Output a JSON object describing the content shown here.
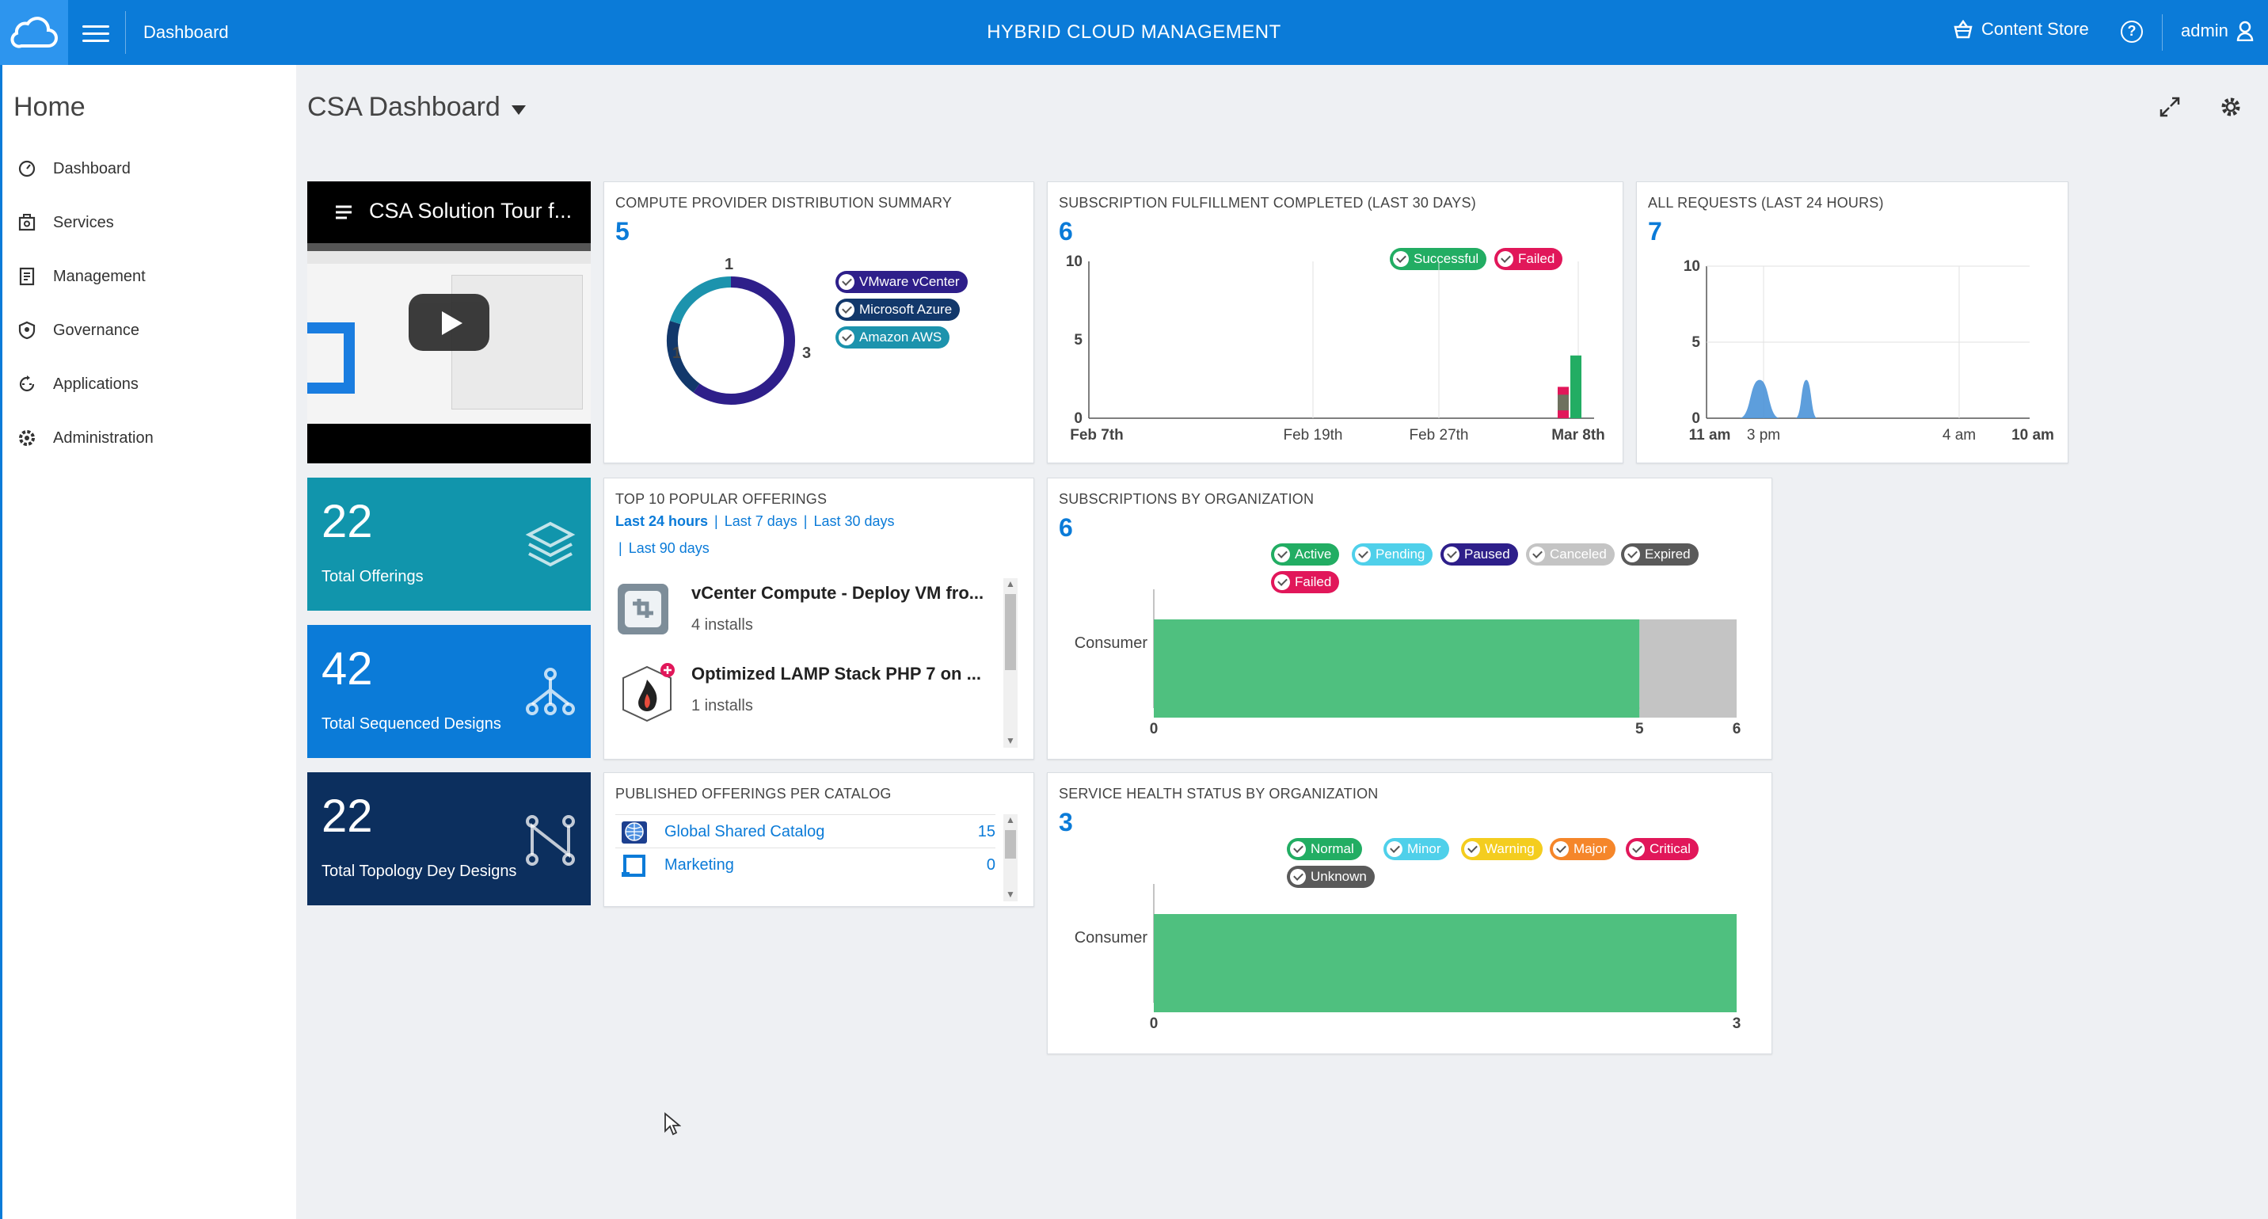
{
  "topbar": {
    "breadcrumb": "Dashboard",
    "title": "HYBRID CLOUD MANAGEMENT",
    "content_store": "Content Store",
    "help": "?",
    "user": "admin"
  },
  "sidebar": {
    "home": "Home",
    "items": [
      {
        "label": "Dashboard",
        "icon": "dashboard-icon"
      },
      {
        "label": "Services",
        "icon": "services-icon"
      },
      {
        "label": "Management",
        "icon": "management-icon"
      },
      {
        "label": "Governance",
        "icon": "governance-icon"
      },
      {
        "label": "Applications",
        "icon": "applications-icon"
      },
      {
        "label": "Administration",
        "icon": "administration-icon"
      }
    ]
  },
  "dashboard": {
    "title": "CSA Dashboard"
  },
  "video": {
    "title": "CSA Solution Tour f..."
  },
  "tiles": [
    {
      "value": "22",
      "label": "Total Offerings",
      "color": "#1195ac",
      "icon": "layers-icon"
    },
    {
      "value": "42",
      "label": "Total Sequenced Designs",
      "color": "#0b7bd8",
      "icon": "hierarchy-icon"
    },
    {
      "value": "22",
      "label": "Total Topology Dey Designs",
      "color": "#0c2f5e",
      "icon": "topology-icon"
    }
  ],
  "compute": {
    "title": "COMPUTE PROVIDER DISTRIBUTION SUMMARY",
    "count": "5",
    "legend": [
      {
        "label": "VMware vCenter",
        "color": "#2e1f8a"
      },
      {
        "label": "Microsoft Azure",
        "color": "#12386b"
      },
      {
        "label": "Amazon AWS",
        "color": "#1c93ad"
      }
    ],
    "labels": [
      "1",
      "1",
      "3"
    ]
  },
  "fulfillment": {
    "title": "SUBSCRIPTION FULFILLMENT COMPLETED (LAST 30 DAYS)",
    "count": "6",
    "legend": [
      {
        "label": "Successful",
        "color": "#22ad63"
      },
      {
        "label": "Failed",
        "color": "#e1175a"
      }
    ]
  },
  "requests": {
    "title": "ALL REQUESTS (LAST 24 HOURS)",
    "count": "7"
  },
  "popular": {
    "title": "TOP 10 POPULAR OFFERINGS",
    "filters": [
      "Last 24 hours",
      "Last 7 days",
      "Last 30 days",
      "Last 90 days"
    ],
    "items": [
      {
        "name": "vCenter Compute - Deploy VM fro...",
        "installs": "4 installs"
      },
      {
        "name": "Optimized LAMP Stack PHP 7 on ...",
        "installs": "1 installs"
      }
    ]
  },
  "suborg": {
    "title": "SUBSCRIPTIONS BY ORGANIZATION",
    "count": "6",
    "legend": [
      {
        "label": "Active",
        "color": "#22ad63"
      },
      {
        "label": "Pending",
        "color": "#4fd0ea"
      },
      {
        "label": "Paused",
        "color": "#2e1f8a"
      },
      {
        "label": "Canceled",
        "color": "#c4c4c4"
      },
      {
        "label": "Expired",
        "color": "#5a5a5a"
      },
      {
        "label": "Failed",
        "color": "#e1175a"
      }
    ]
  },
  "catalog": {
    "title": "PUBLISHED OFFERINGS PER CATALOG",
    "rows": [
      {
        "name": "Global Shared Catalog",
        "count": "15"
      },
      {
        "name": "Marketing",
        "count": "0"
      }
    ]
  },
  "health": {
    "title": "SERVICE HEALTH STATUS BY ORGANIZATION",
    "count": "3",
    "legend": [
      {
        "label": "Normal",
        "color": "#22ad63"
      },
      {
        "label": "Minor",
        "color": "#4fd0ea"
      },
      {
        "label": "Warning",
        "color": "#f4cd1f"
      },
      {
        "label": "Major",
        "color": "#f5862a"
      },
      {
        "label": "Critical",
        "color": "#e1175a"
      },
      {
        "label": "Unknown",
        "color": "#5a5a5a"
      }
    ]
  },
  "chart_data": [
    {
      "type": "pie",
      "title": "COMPUTE PROVIDER DISTRIBUTION SUMMARY",
      "categories": [
        "VMware vCenter",
        "Microsoft Azure",
        "Amazon AWS"
      ],
      "values": [
        3,
        1,
        1
      ]
    },
    {
      "type": "bar",
      "title": "SUBSCRIPTION FULFILLMENT COMPLETED (LAST 30 DAYS)",
      "x_ticks": [
        "Feb 7th",
        "Feb 19th",
        "Feb 27th",
        "Mar 8th"
      ],
      "y_ticks": [
        "0",
        "5",
        "10"
      ],
      "ylim": [
        0,
        10
      ],
      "series": [
        {
          "name": "Successful",
          "x": [
            "Mar 8th"
          ],
          "values": [
            4
          ]
        },
        {
          "name": "Failed",
          "x": [
            "Mar 8th"
          ],
          "values": [
            2
          ]
        }
      ]
    },
    {
      "type": "area",
      "title": "ALL REQUESTS (LAST 24 HOURS)",
      "x_ticks": [
        "11 am",
        "3 pm",
        "4 am",
        "10 am"
      ],
      "y_ticks": [
        "0",
        "5",
        "10"
      ],
      "ylim": [
        0,
        10
      ],
      "series": [
        {
          "x": [
            "1 pm",
            "4 pm"
          ],
          "values": [
            2,
            2
          ]
        }
      ]
    },
    {
      "type": "bar",
      "title": "SUBSCRIPTIONS BY ORGANIZATION",
      "categories": [
        "Consumer"
      ],
      "x_ticks": [
        "0",
        "5",
        "6"
      ],
      "xlim": [
        0,
        6
      ],
      "series": [
        {
          "name": "Active",
          "values": [
            5
          ]
        },
        {
          "name": "Canceled",
          "values": [
            1
          ]
        }
      ]
    },
    {
      "type": "bar",
      "title": "SERVICE HEALTH STATUS BY ORGANIZATION",
      "categories": [
        "Consumer"
      ],
      "x_ticks": [
        "0",
        "3"
      ],
      "xlim": [
        0,
        3
      ],
      "series": [
        {
          "name": "Normal",
          "values": [
            3
          ]
        }
      ]
    }
  ]
}
